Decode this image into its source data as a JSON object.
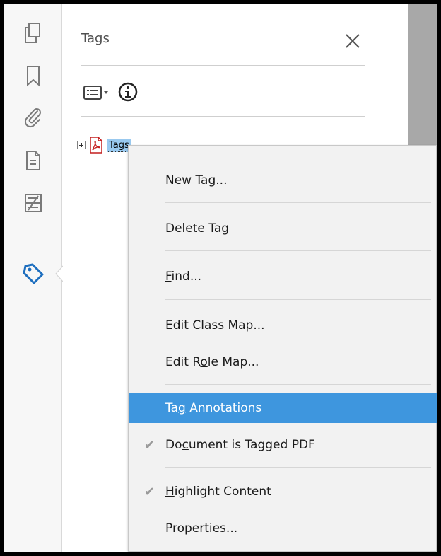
{
  "rail": {
    "icons": [
      "pages-icon",
      "bookmark-icon",
      "attachment-icon",
      "document-icon",
      "content-icon",
      "tag-icon"
    ],
    "active": "tag-icon"
  },
  "panel": {
    "title": "Tags",
    "tree": {
      "root_label": "Tags"
    }
  },
  "context_menu": {
    "items": [
      {
        "pre": "",
        "key": "N",
        "post": "ew Tag...",
        "checked": false,
        "highlighted": false
      },
      {
        "pre": "",
        "key": "D",
        "post": "elete Tag",
        "checked": false,
        "highlighted": false
      },
      {
        "pre": "",
        "key": "F",
        "post": "ind...",
        "checked": false,
        "highlighted": false
      },
      {
        "pre": "Edit C",
        "key": "l",
        "post": "ass Map...",
        "checked": false,
        "highlighted": false
      },
      {
        "pre": "Edit R",
        "key": "o",
        "post": "le Map...",
        "checked": false,
        "highlighted": false
      },
      {
        "pre": "Ta",
        "key": "g",
        "post": " Annotations",
        "checked": false,
        "highlighted": true
      },
      {
        "pre": "Do",
        "key": "c",
        "post": "ument is Tagged PDF",
        "checked": true,
        "highlighted": false
      },
      {
        "pre": "",
        "key": "H",
        "post": "ighlight Content",
        "checked": true,
        "highlighted": false
      },
      {
        "pre": "",
        "key": "P",
        "post": "roperties...",
        "checked": false,
        "highlighted": false
      }
    ],
    "check_glyph": "✔"
  },
  "colors": {
    "accent": "#3e96de",
    "active_icon": "#1e6fbf",
    "tree_selection": "#99c9ef"
  }
}
